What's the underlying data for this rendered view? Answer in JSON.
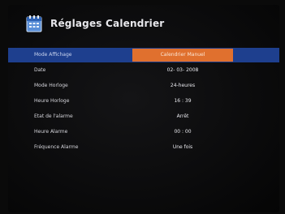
{
  "header": {
    "title": "Réglages Calendrier",
    "icon": "calendar-icon"
  },
  "settings": [
    {
      "label": "Mode Affichage",
      "value": "Calendrier Manuel",
      "selected": true
    },
    {
      "label": "Date",
      "value": "02-  03-  2008"
    },
    {
      "label": "Mode Horloge",
      "value": "24-heures"
    },
    {
      "label": "Heure Horloge",
      "value": "16  :  39"
    },
    {
      "label": "Etat de l'alarme",
      "value": "Arrêt"
    },
    {
      "label": "Heure Alarme",
      "value": "00  :  00"
    },
    {
      "label": "Fréquence Alarme",
      "value": "Une fois"
    }
  ],
  "colors": {
    "selected_row": "#1e3f8e",
    "selected_value": "#e0702e"
  }
}
